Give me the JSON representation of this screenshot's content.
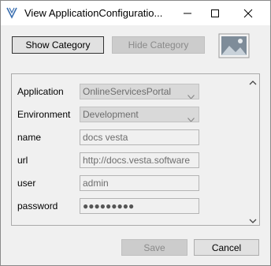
{
  "window": {
    "title": "View ApplicationConfiguratio..."
  },
  "toolbar": {
    "show_category_label": "Show Category",
    "hide_category_label": "Hide Category"
  },
  "form": {
    "application": {
      "label": "Application",
      "value": "OnlineServicesPortal"
    },
    "environment": {
      "label": "Environment",
      "value": "Development"
    },
    "name": {
      "label": "name",
      "value": "docs vesta"
    },
    "url": {
      "label": "url",
      "value": "http://docs.vesta.software"
    },
    "user": {
      "label": "user",
      "value": "admin"
    },
    "password": {
      "label": "password",
      "value": "●●●●●●●●●"
    }
  },
  "footer": {
    "save_label": "Save",
    "cancel_label": "Cancel"
  },
  "colors": {
    "accent_logo": "#3a6fb0",
    "disabled_text": "#8a8a8a"
  }
}
